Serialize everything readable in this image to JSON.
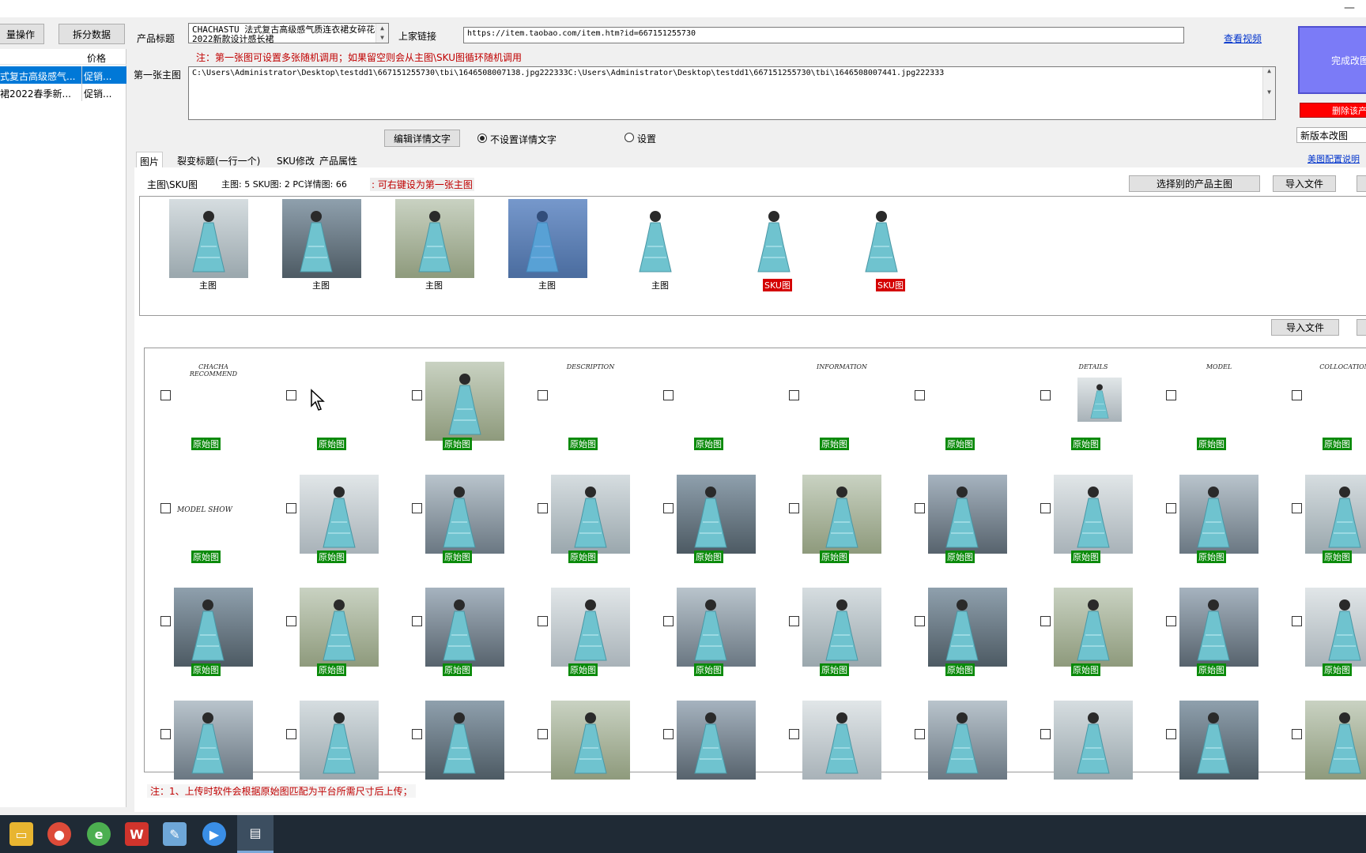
{
  "toolbar": {
    "batch_btn": "量操作",
    "split_btn": "拆分数据"
  },
  "list": {
    "col_price": "价格",
    "rows": [
      {
        "title": "式复古高级感气...",
        "price": "促销...",
        "selected": true
      },
      {
        "title": "裙2022春季新...",
        "price": "促销...",
        "selected": false
      }
    ]
  },
  "form": {
    "product_title_label": "产品标题",
    "product_title_value": "CHACHASTU 法式复古高级感气质连衣裙女碎花春2022新款设计感长裙",
    "link_label": "上家链接",
    "link_value": "https://item.taobao.com/item.htm?id=667151255730",
    "view_video": "查看视频",
    "notice": "注：第一张图可设置多张随机调用；如果留空则会从主图\\SKU图循环随机调用",
    "first_main_label": "第一张主图",
    "first_main_value": "C:\\Users\\Administrator\\Desktop\\testdd1\\667151255730\\tbi\\1646508007138.jpg222333C:\\Users\\Administrator\\Desktop\\testdd1\\667151255730\\tbi\\1646508007441.jpg222333",
    "edit_detail_btn": "编辑详情文字",
    "radio_no_set": "不设置详情文字",
    "radio_set": "设置"
  },
  "right_panel": {
    "complete_btn": "完成改图",
    "delete_btn": "删除该产",
    "version_select": "新版本改图",
    "meitu_link": "美图配置说明"
  },
  "tabs": [
    "图片",
    "裂变标题(一行一个)",
    "SKU修改",
    "产品属性"
  ],
  "images_section": {
    "heading": "主图\\SKU图",
    "counts": "主图: 5  SKU图: 2 PC详情图: 66",
    "hint": ": 可右键设为第一张主图",
    "choose_other_btn": "选择别的产品主图",
    "import_btn": "导入文件",
    "import_btn2": "导入文件",
    "main_thumbs": [
      {
        "caption": "主图",
        "type": "main"
      },
      {
        "caption": "主图",
        "type": "main"
      },
      {
        "caption": "主图",
        "type": "main"
      },
      {
        "caption": "主图",
        "type": "main"
      },
      {
        "caption": "主图",
        "type": "main"
      },
      {
        "caption": "SKU图",
        "type": "sku"
      },
      {
        "caption": "SKU图",
        "type": "sku"
      }
    ],
    "detail_caption": "原始图",
    "detail_texts": {
      "recommend": "CHACHA RECOMMEND",
      "description": "DESCRIPTION",
      "information": "INFORMATION",
      "details": "DETAILS",
      "model": "MODEL",
      "collocation": "COLLOCATION",
      "model_show": "MODEL SHOW"
    }
  },
  "footer_note": "注：1、上传时软件会根据原始图匹配为平台所需尺寸后上传；",
  "taskbar": {
    "icons": [
      "folder-icon",
      "chrome-icon",
      "ie-icon",
      "wps-icon",
      "notes-icon",
      "meeting-icon",
      "app-icon"
    ]
  },
  "colors": {
    "selected_row": "#0078d7",
    "caption_green": "#0a8a0a",
    "caption_red": "#d40000",
    "complete_btn": "#7b7bf7",
    "delete_btn": "#ff0000"
  }
}
